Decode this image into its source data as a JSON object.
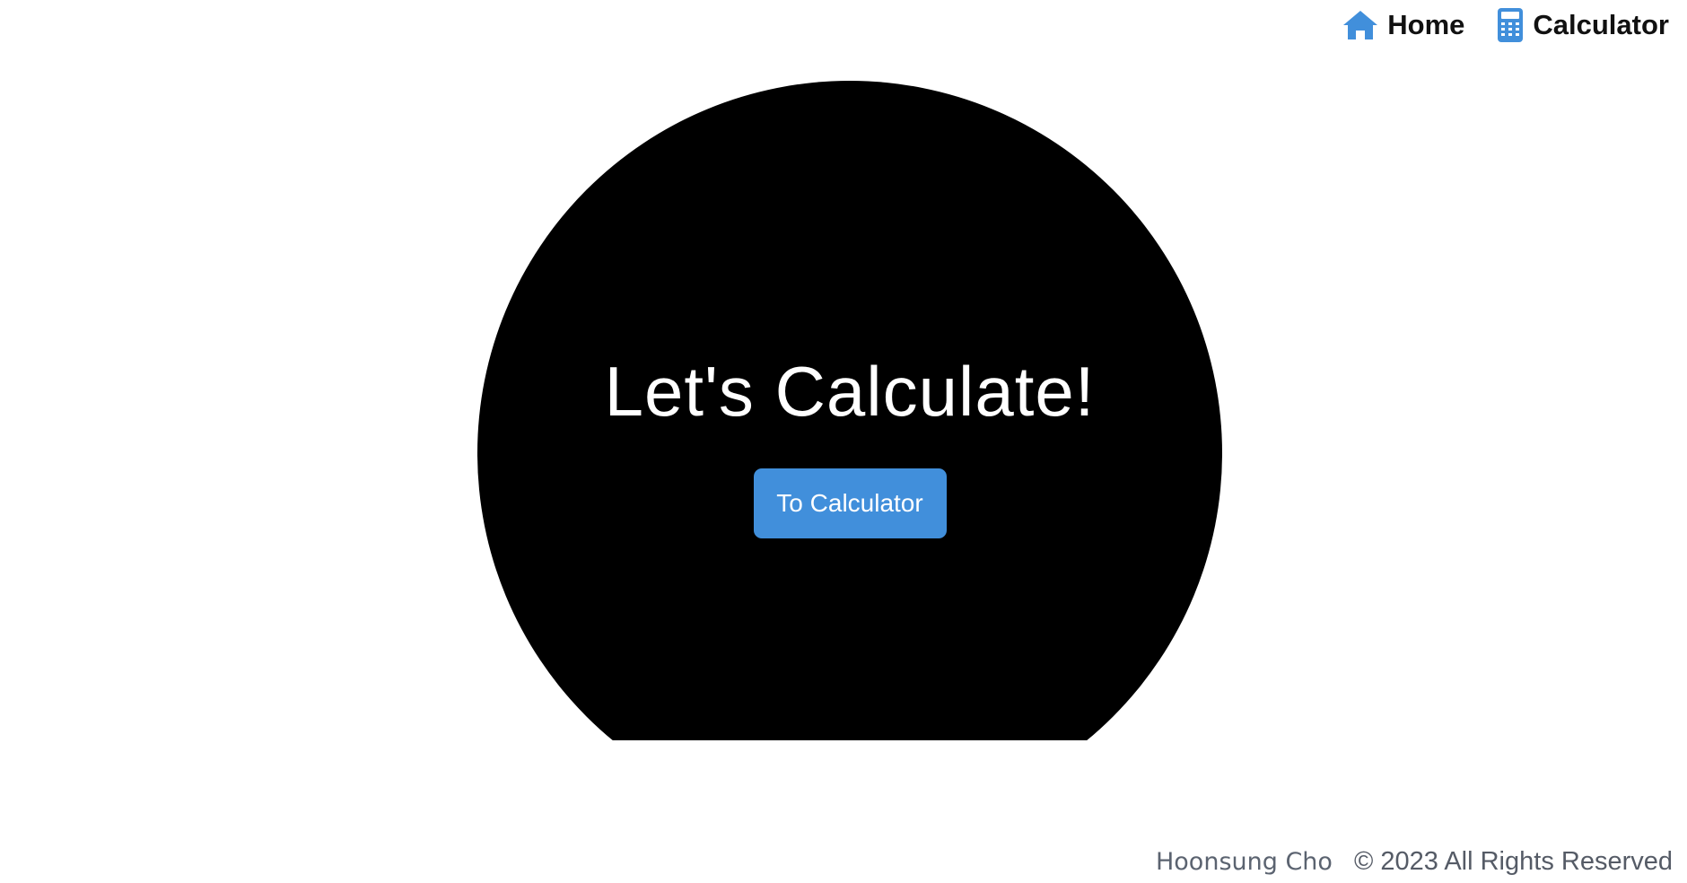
{
  "nav": {
    "items": [
      {
        "label": "Home",
        "icon": "home-icon"
      },
      {
        "label": "Calculator",
        "icon": "calculator-icon"
      }
    ],
    "accent_color": "#418fdb"
  },
  "hero": {
    "title": "Let's Calculate!",
    "button_label": "To Calculator",
    "background_color": "#000000",
    "button_color": "#418fdb"
  },
  "footer": {
    "author": "Hoonsung Cho",
    "copyright": "© 2023 All Rights Reserved"
  }
}
